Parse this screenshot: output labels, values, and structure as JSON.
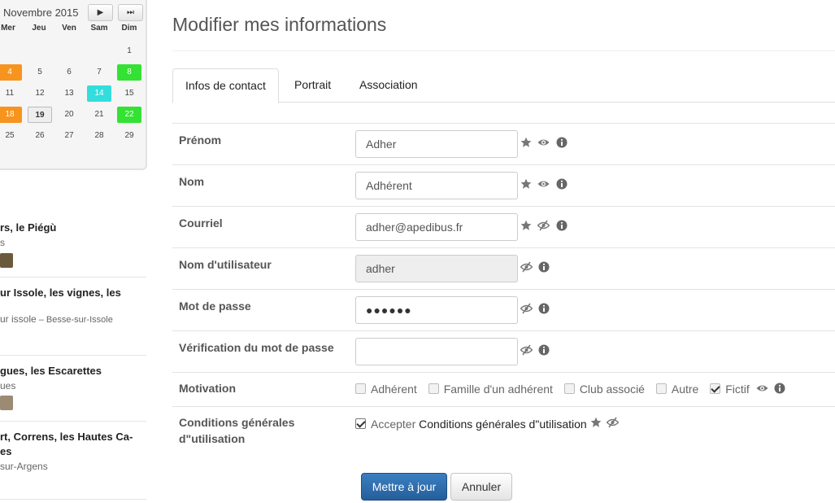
{
  "calendar": {
    "month": "Novembre 2015",
    "nav_next": "▶",
    "nav_last": "⏭",
    "weekdays": [
      "Mer",
      "Jeu",
      "Ven",
      "Sam",
      "Dim"
    ],
    "rows": [
      [
        "",
        "",
        "",
        "",
        "1"
      ],
      [
        "4",
        "5",
        "6",
        "7",
        "8"
      ],
      [
        "11",
        "12",
        "13",
        "14",
        "15"
      ],
      [
        "18",
        "19",
        "20",
        "21",
        "22"
      ],
      [
        "25",
        "26",
        "27",
        "28",
        "29"
      ]
    ]
  },
  "hikes": [
    {
      "title": "rs, le Piégù",
      "sub": "s"
    },
    {
      "title": "ur Issole, les vignes, les",
      "sub": "ur issole",
      "sub2": " – Besse-sur-Issole"
    },
    {
      "title": "gues, les Escarettes",
      "sub": "ues"
    },
    {
      "title_line1": "rt, Correns, les Hautes Ca-",
      "title_line2": "es",
      "sub": "sur-Argens"
    }
  ],
  "page": {
    "title": "Modifier mes informations"
  },
  "tabs": [
    "Infos de contact",
    "Portrait",
    "Association"
  ],
  "fields": {
    "prenom": {
      "label": "Prénom",
      "value": "Adher"
    },
    "nom": {
      "label": "Nom",
      "value": "Adhérent"
    },
    "courriel": {
      "label": "Courriel",
      "value": "adher@apedibus.fr"
    },
    "username": {
      "label": "Nom d'utilisateur",
      "value": "adher"
    },
    "password": {
      "label": "Mot de passe",
      "value": "●●●●●●"
    },
    "password_check": {
      "label": "Vérification du mot de passe",
      "value": ""
    },
    "motivation": {
      "label": "Motivation",
      "options": [
        {
          "label": "Adhérent",
          "checked": false
        },
        {
          "label": "Famille d'un adhérent",
          "checked": false
        },
        {
          "label": "Club associé",
          "checked": false
        },
        {
          "label": "Autre",
          "checked": false
        },
        {
          "label": "Fictif",
          "checked": true
        }
      ]
    },
    "conditions": {
      "label_line1": "Conditions générales",
      "label_line2": "d\"utilisation",
      "accept": "Accepter",
      "link": "Conditions générales d\"utilisation"
    }
  },
  "buttons": {
    "update": "Mettre à jour",
    "cancel": "Annuler"
  },
  "colors": {
    "primary": "#2f6fae",
    "cal_orange": "#f7941e",
    "cal_green": "#33e233",
    "cal_cyan": "#33dddd"
  }
}
